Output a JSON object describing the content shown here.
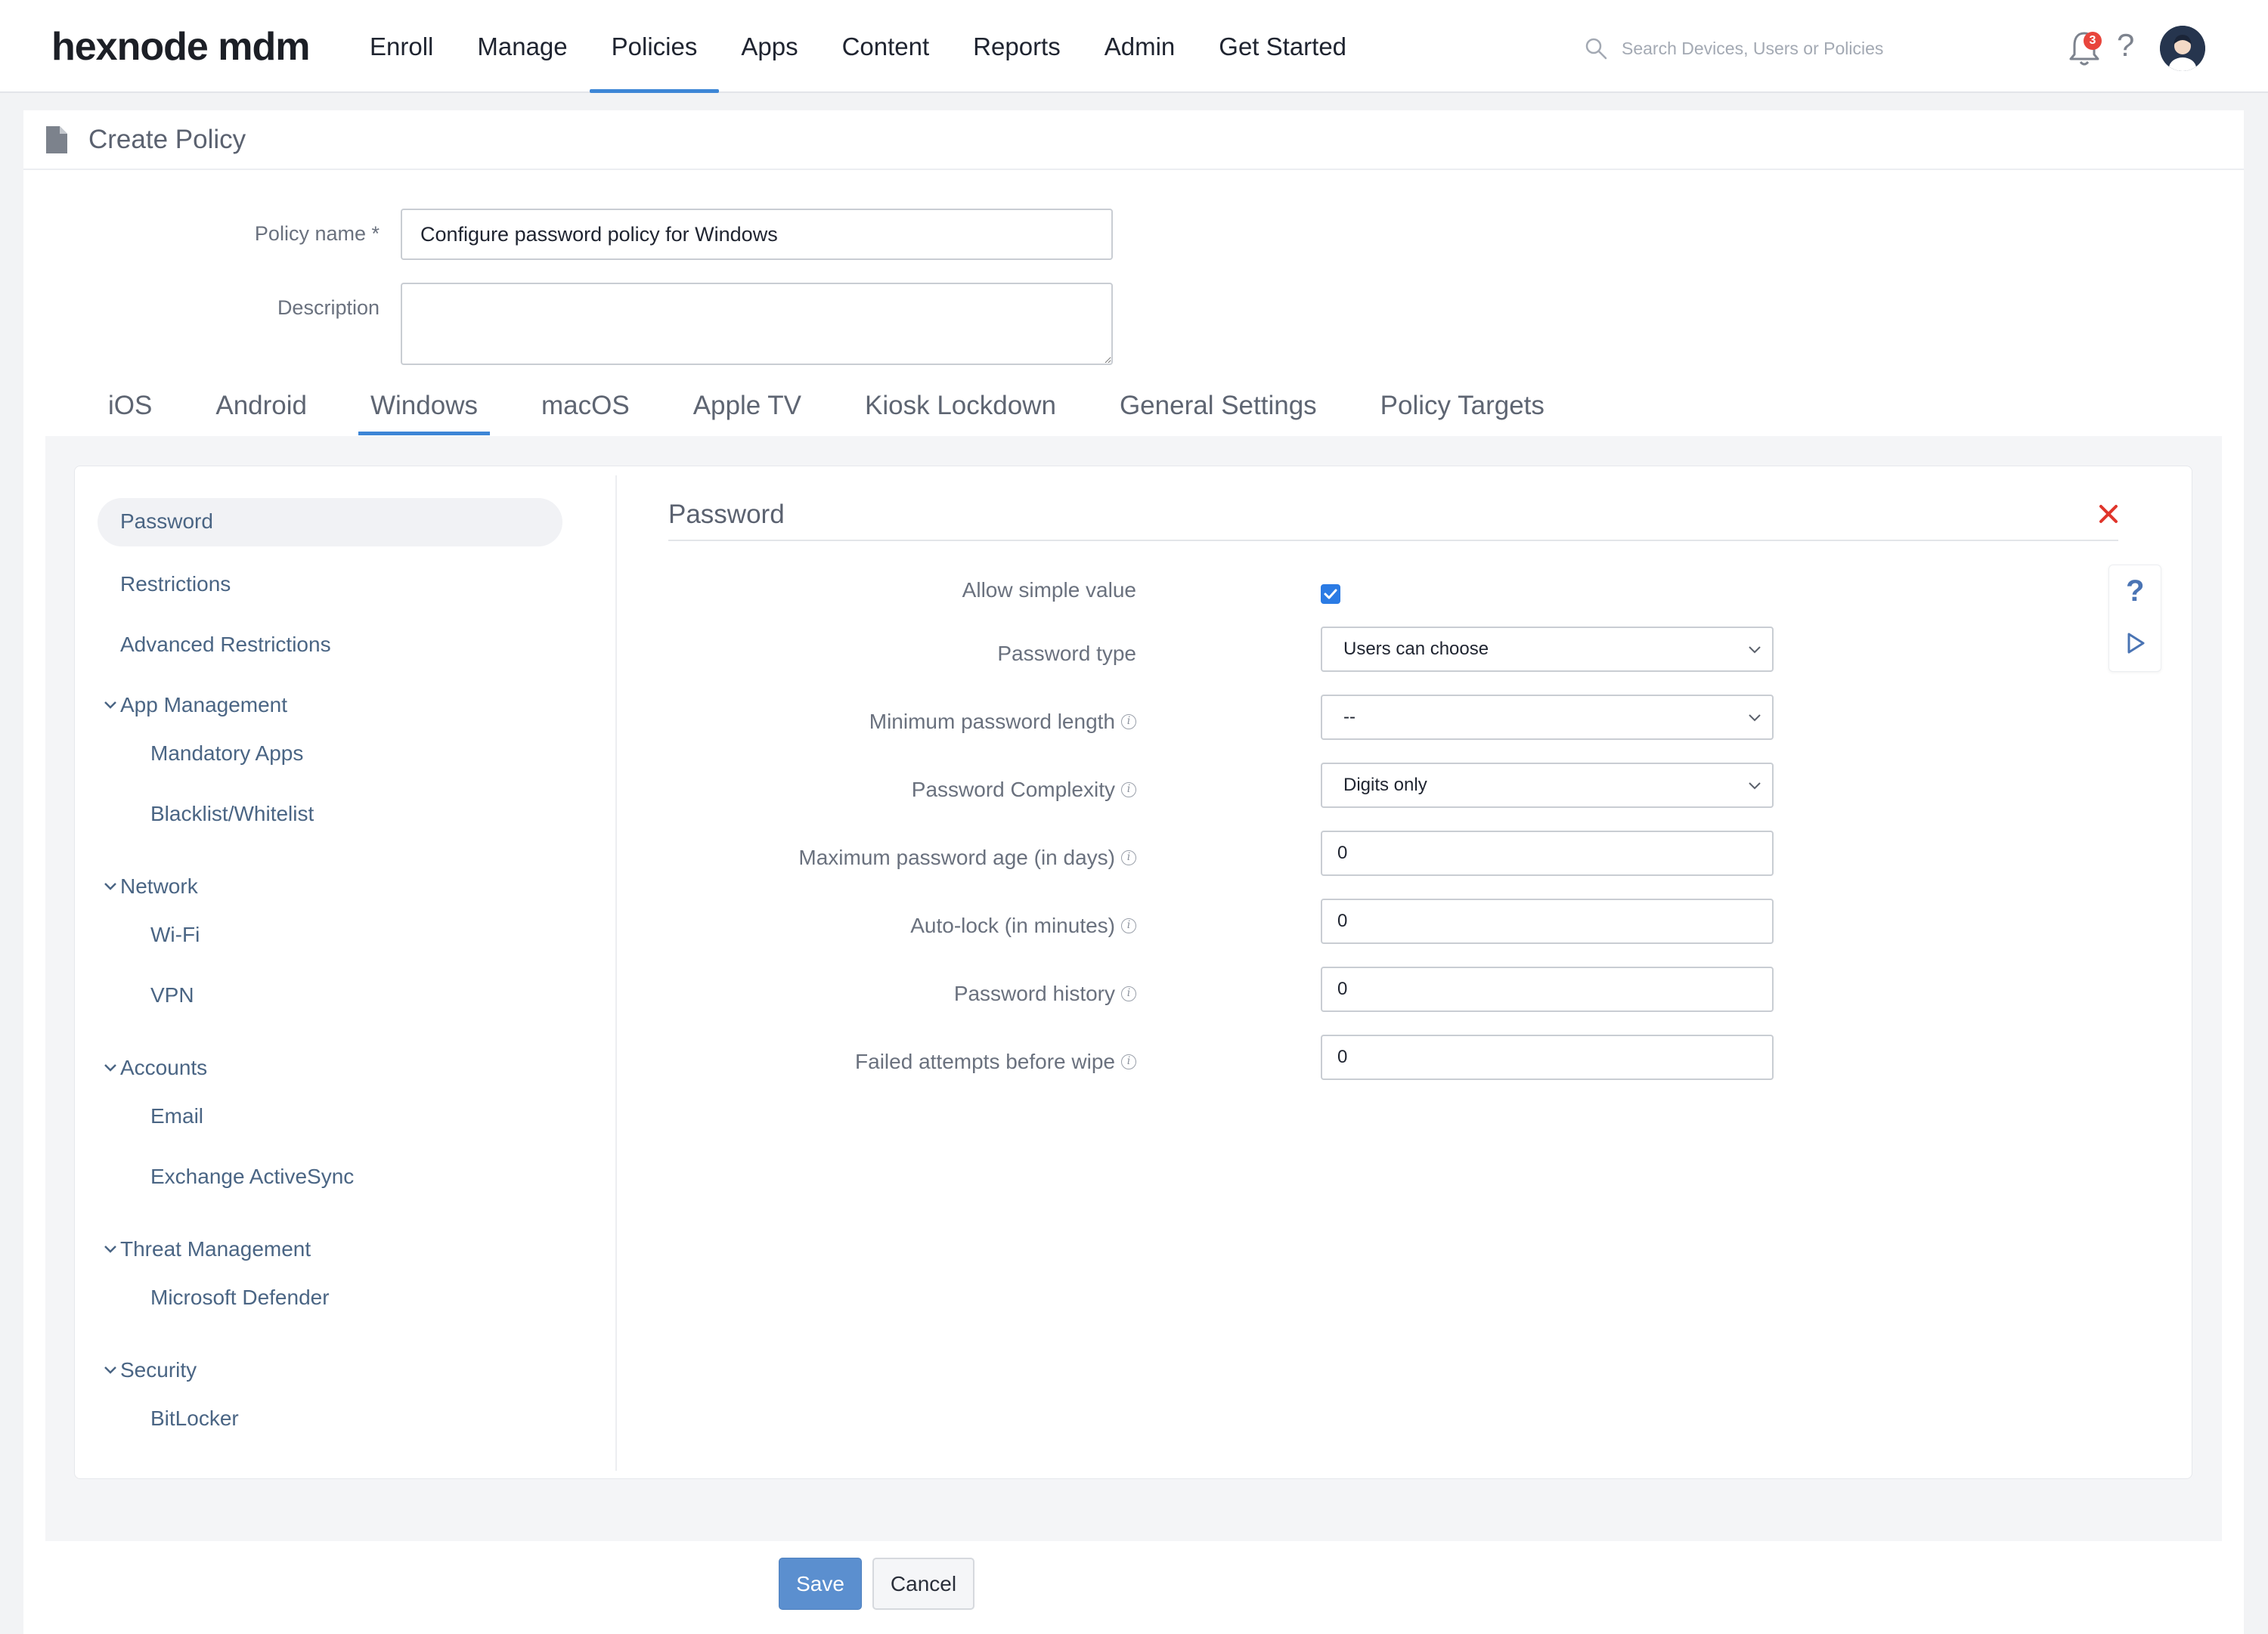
{
  "brand": "hexnode mdm",
  "nav": [
    "Enroll",
    "Manage",
    "Policies",
    "Apps",
    "Content",
    "Reports",
    "Admin",
    "Get Started"
  ],
  "nav_active": "Policies",
  "search": {
    "placeholder": "Search Devices, Users or Policies"
  },
  "notifications": {
    "count": "3"
  },
  "help_icon": "?",
  "page": {
    "title": "Create Policy"
  },
  "form": {
    "policy_name_label": "Policy name *",
    "policy_name_value": "Configure password policy for Windows",
    "description_label": "Description",
    "description_value": ""
  },
  "tabs": [
    "iOS",
    "Android",
    "Windows",
    "macOS",
    "Apple TV",
    "Kiosk Lockdown",
    "General Settings",
    "Policy Targets"
  ],
  "tab_active": "Windows",
  "sidebar": {
    "password": "Password",
    "restrictions": "Restrictions",
    "advanced_restrictions": "Advanced Restrictions",
    "app_management": "App Management",
    "mandatory_apps": "Mandatory Apps",
    "blacklist_whitelist": "Blacklist/Whitelist",
    "network": "Network",
    "wifi": "Wi-Fi",
    "vpn": "VPN",
    "accounts": "Accounts",
    "email": "Email",
    "exchange_activesync": "Exchange ActiveSync",
    "threat_management": "Threat Management",
    "microsoft_defender": "Microsoft Defender",
    "security": "Security",
    "bitlocker": "BitLocker"
  },
  "panel": {
    "title": "Password",
    "allow_simple_label": "Allow simple value",
    "allow_simple_checked": true,
    "password_type_label": "Password type",
    "password_type_value": "Users can choose",
    "min_length_label": "Minimum password length",
    "min_length_value": "--",
    "complexity_label": "Password Complexity",
    "complexity_value": "Digits only",
    "max_age_label": "Maximum password age (in days)",
    "max_age_value": "0",
    "autolock_label": "Auto-lock (in minutes)",
    "autolock_value": "0",
    "history_label": "Password history",
    "history_value": "0",
    "failed_attempts_label": "Failed attempts before wipe",
    "failed_attempts_value": "0"
  },
  "buttons": {
    "save": "Save",
    "cancel": "Cancel"
  },
  "colors": {
    "accent": "#3d86d6",
    "save_button": "#5b8fcf",
    "close": "#e0352b",
    "checkbox": "#2b7be4"
  }
}
